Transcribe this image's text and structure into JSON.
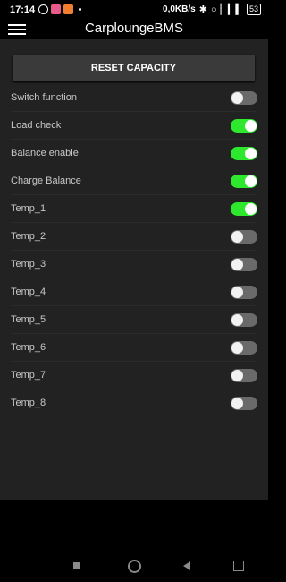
{
  "status_bar": {
    "time": "17:14",
    "net_speed": "0,0KB/s",
    "battery": "53",
    "notification_icons": [
      "messenger-icon",
      "app-icon",
      "app-icon"
    ]
  },
  "app_bar": {
    "title": "CarploungeBMS",
    "menu_icon": "hamburger-icon"
  },
  "main": {
    "reset_button": "RESET CAPACITY",
    "settings": [
      {
        "label": "Switch function",
        "on": false
      },
      {
        "label": "Load check",
        "on": true
      },
      {
        "label": "Balance enable",
        "on": true
      },
      {
        "label": "Charge Balance",
        "on": true
      },
      {
        "label": "Temp_1",
        "on": true
      },
      {
        "label": "Temp_2",
        "on": false
      },
      {
        "label": "Temp_3",
        "on": false
      },
      {
        "label": "Temp_4",
        "on": false
      },
      {
        "label": "Temp_5",
        "on": false
      },
      {
        "label": "Temp_6",
        "on": false
      },
      {
        "label": "Temp_7",
        "on": false
      },
      {
        "label": "Temp_8",
        "on": false
      }
    ]
  },
  "colors": {
    "toggle_on": "#2ee82e",
    "toggle_off": "#6a6a6a",
    "content_bg": "#222222",
    "button_bg": "#3a3a3a"
  },
  "nav_bar": {
    "buttons": [
      "recents-icon",
      "home-icon",
      "back-icon",
      "screenshot-icon"
    ]
  }
}
